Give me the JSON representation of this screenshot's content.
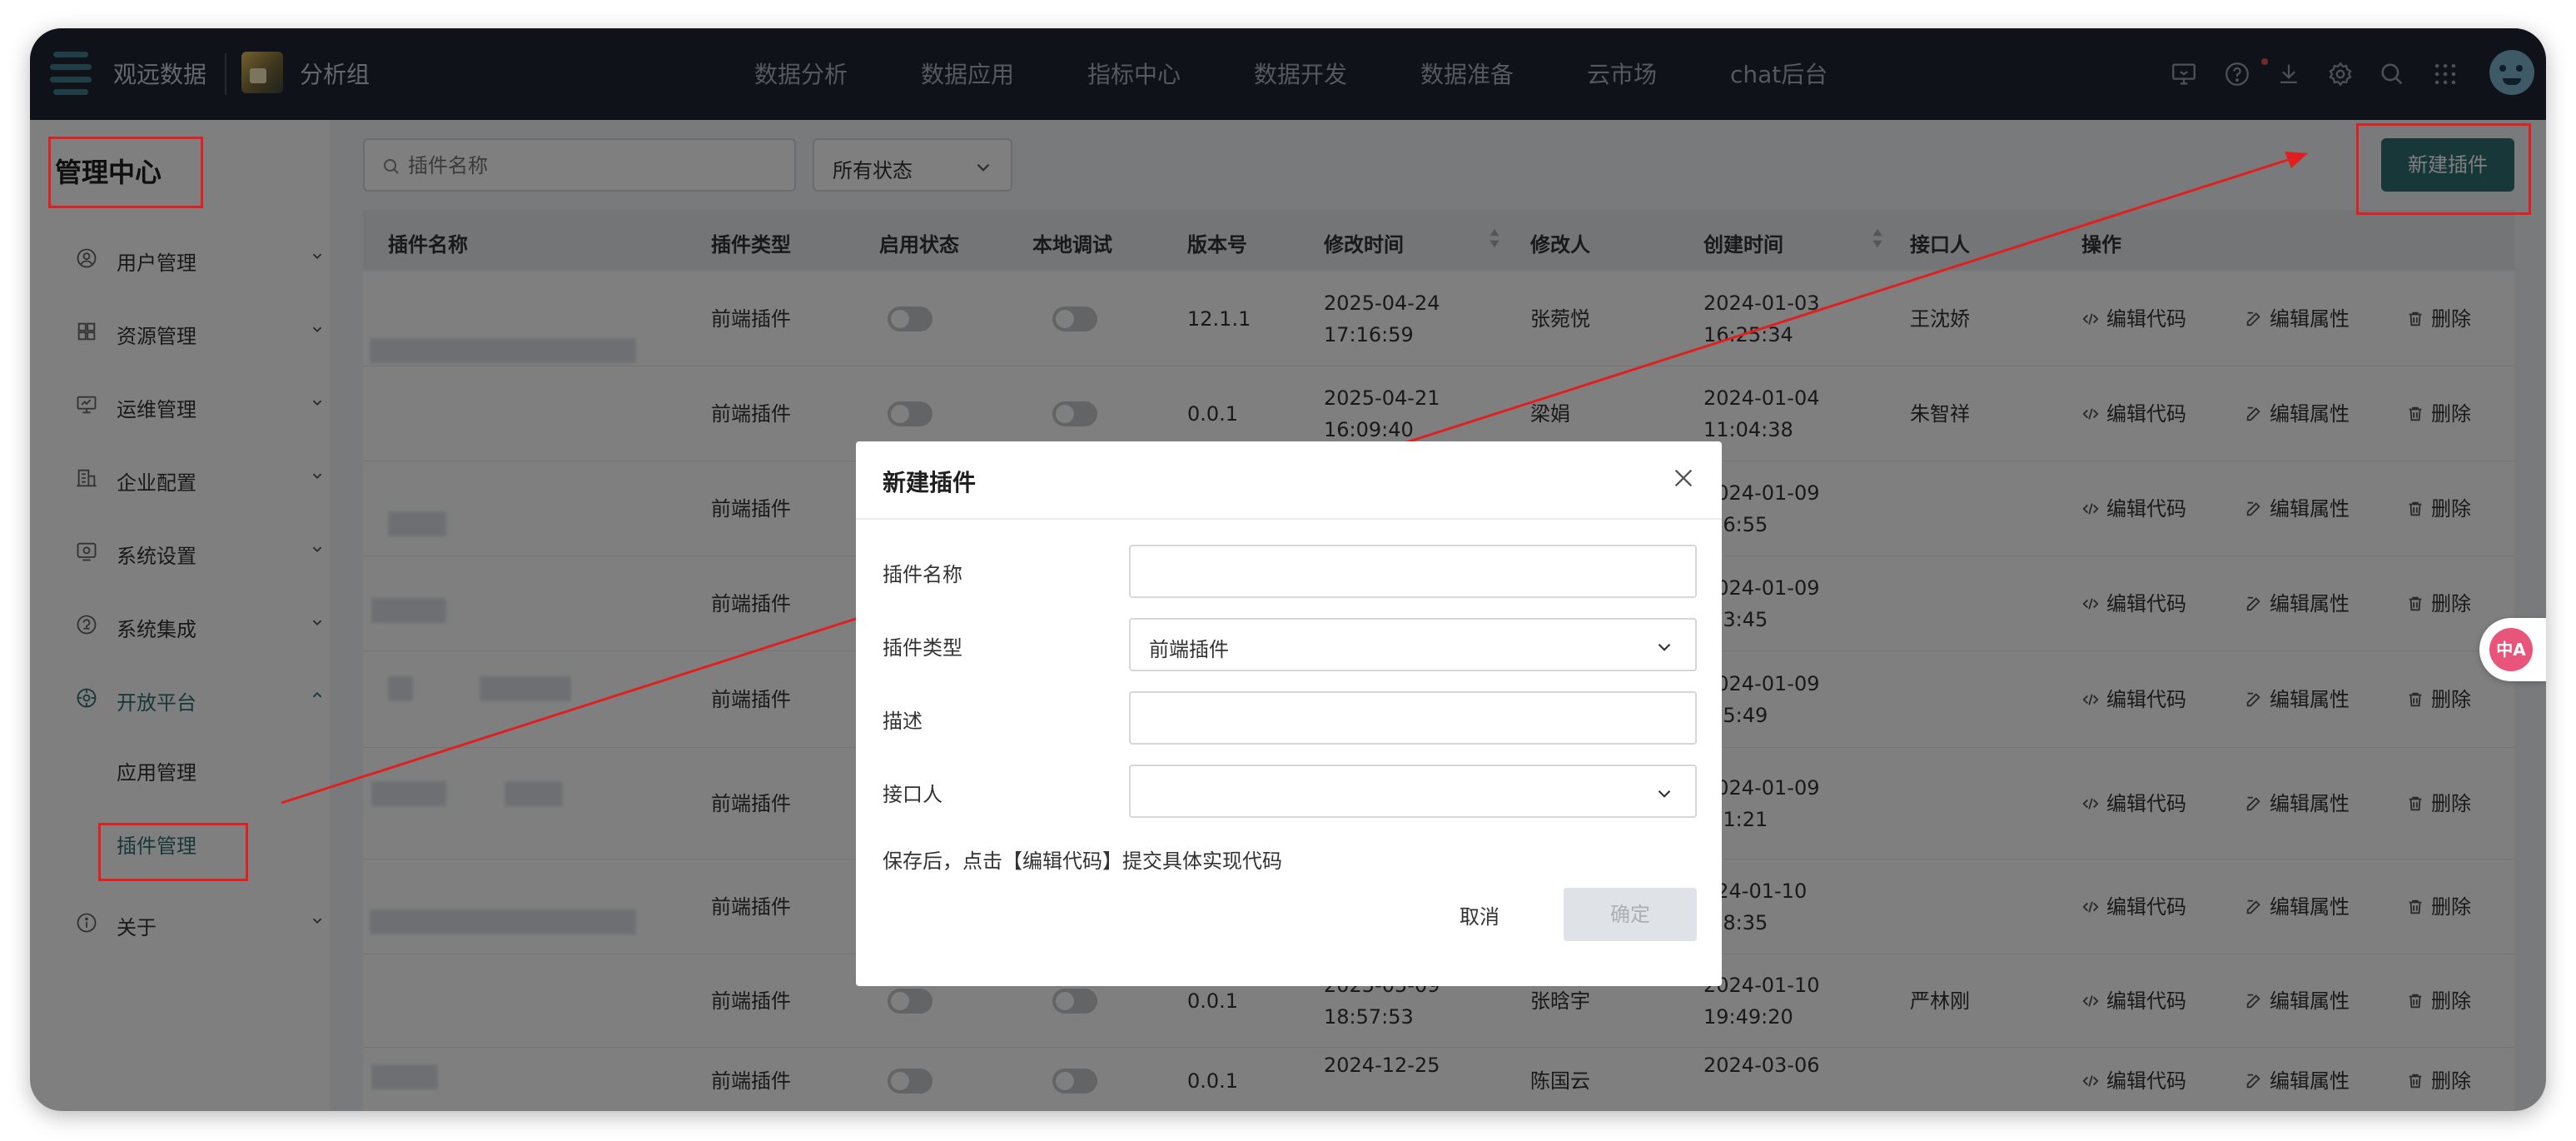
{
  "topbar": {
    "brand": "观远数据",
    "group": "分析组",
    "nav": [
      "数据分析",
      "数据应用",
      "指标中心",
      "数据开发",
      "数据准备",
      "云市场",
      "chat后台"
    ],
    "icons": [
      "screen-icon",
      "help-icon",
      "download-icon",
      "settings-icon",
      "search-icon",
      "apps-grid-icon",
      "user-avatar"
    ]
  },
  "sidebar": {
    "title": "管理中心",
    "items": [
      {
        "label": "用户管理",
        "icon": "user-icon"
      },
      {
        "label": "资源管理",
        "icon": "resource-icon"
      },
      {
        "label": "运维管理",
        "icon": "monitor-icon"
      },
      {
        "label": "企业配置",
        "icon": "building-icon"
      },
      {
        "label": "系统设置",
        "icon": "system-icon"
      },
      {
        "label": "系统集成",
        "icon": "integration-icon"
      },
      {
        "label": "开放平台",
        "icon": "open-platform-icon"
      },
      {
        "label": "关于",
        "icon": "info-icon"
      }
    ],
    "subitems": [
      "应用管理",
      "插件管理"
    ]
  },
  "toolbar": {
    "search_placeholder": "插件名称",
    "status_select": "所有状态",
    "new_button": "新建插件"
  },
  "table": {
    "columns": [
      "插件名称",
      "插件类型",
      "启用状态",
      "本地调试",
      "版本号",
      "修改时间",
      "修改人",
      "创建时间",
      "接口人",
      "操作"
    ],
    "actions": [
      "编辑代码",
      "编辑属性",
      "删除"
    ],
    "rows": [
      {
        "type": "前端插件",
        "version": "12.1.1",
        "modified_date": "2025-04-24",
        "modified_time": "17:16:59",
        "modifier": "张菀悦",
        "created_date": "2024-01-03",
        "created_time": "16:25:34",
        "contact": "王沈娇"
      },
      {
        "type": "前端插件",
        "version": "0.0.1",
        "modified_date": "2025-04-21",
        "modified_time": "16:09:40",
        "modifier": "梁娟",
        "created_date": "2024-01-04",
        "created_time": "11:04:38",
        "contact": "朱智祥"
      },
      {
        "type": "前端插件",
        "version": "",
        "modified_date": "",
        "modified_time": "",
        "modifier": "",
        "created_date": "2024-01-09",
        "created_time": ":56:55",
        "contact": ""
      },
      {
        "type": "前端插件",
        "version": "",
        "modified_date": "",
        "modified_time": "",
        "modifier": "",
        "created_date": "2024-01-09",
        "created_time": ":03:45",
        "contact": ""
      },
      {
        "type": "前端插件",
        "version": "",
        "modified_date": "",
        "modified_time": "",
        "modifier": "",
        "created_date": "2024-01-09",
        "created_time": ":05:49",
        "contact": ""
      },
      {
        "type": "前端插件",
        "version": "",
        "modified_date": "",
        "modified_time": "",
        "modifier": "",
        "created_date": "2024-01-09",
        "created_time": ":11:21",
        "contact": ""
      },
      {
        "type": "前端插件",
        "version": "",
        "modified_date": "",
        "modified_time": "",
        "modifier": "",
        "created_date": "024-01-10",
        "created_time": ":48:35",
        "contact": ""
      },
      {
        "type": "前端插件",
        "version": "0.0.1",
        "modified_date": "2025-05-09",
        "modified_time": "18:57:53",
        "modifier": "张晗宇",
        "created_date": "2024-01-10",
        "created_time": "19:49:20",
        "contact": "严林刚"
      },
      {
        "type": "前端插件",
        "version": "0.0.1",
        "modified_date": "2024-12-25",
        "modified_time": "",
        "modifier": "陈国云",
        "created_date": "2024-03-06",
        "created_time": "",
        "contact": ""
      }
    ]
  },
  "dialog": {
    "title": "新建插件",
    "fields": [
      {
        "label": "插件名称",
        "value": ""
      },
      {
        "label": "插件类型",
        "value": "前端插件"
      },
      {
        "label": "描述",
        "value": ""
      },
      {
        "label": "接口人",
        "value": ""
      }
    ],
    "hint": "保存后，点击【编辑代码】提交具体实现代码",
    "cancel": "取消",
    "ok": "确定"
  },
  "translate_badge": "中A",
  "annotation_color": "#e02020",
  "accent_color": "#2f6f73"
}
